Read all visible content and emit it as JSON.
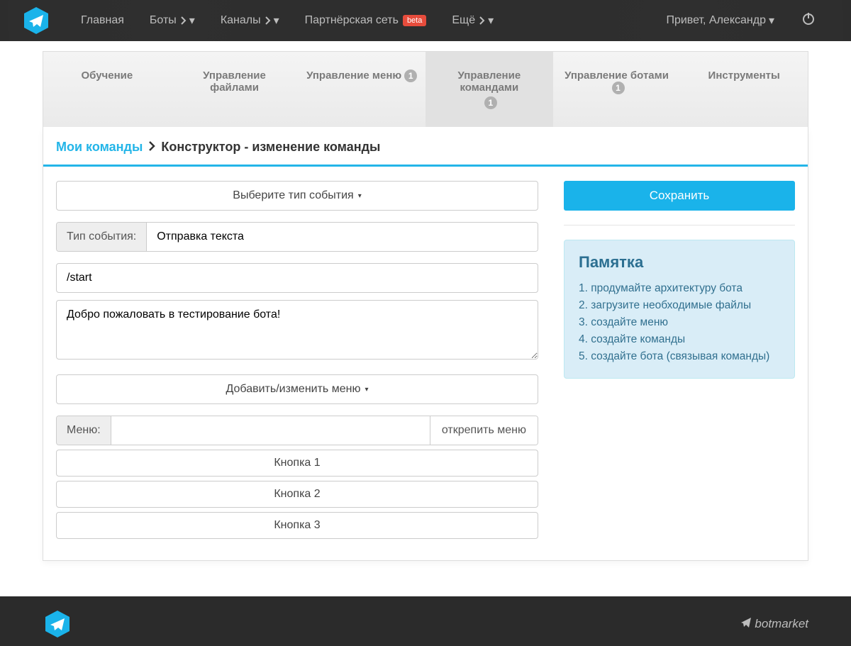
{
  "nav": {
    "home": "Главная",
    "bots": "Боты",
    "channels": "Каналы",
    "partner": "Партнёрская сеть",
    "beta": "beta",
    "more": "Ещё",
    "greeting": "Привет, Александр"
  },
  "tabs": {
    "training": "Обучение",
    "files": "Управление файлами",
    "menu": "Управление меню",
    "menu_badge": "1",
    "commands": "Управление командами",
    "commands_badge": "1",
    "bots": "Управление ботами",
    "bots_badge": "1",
    "tools": "Инструменты"
  },
  "breadcrumb": {
    "link": "Мои команды",
    "current": "Конструктор - изменение команды"
  },
  "form": {
    "select_event_type": "Выберите тип события",
    "event_type_label": "Тип события:",
    "event_type_value": "Отправка текста",
    "command": "/start",
    "message": "Добро пожаловать в тестирование бота!",
    "add_change_menu": "Добавить/изменить меню",
    "menu_label": "Меню:",
    "menu_value": "",
    "unpin_menu": "открепить меню",
    "buttons": [
      "Кнопка 1",
      "Кнопка 2",
      "Кнопка 3"
    ]
  },
  "side": {
    "save": "Сохранить",
    "memo_title": "Памятка",
    "memo_items": [
      "продумайте архитектуру бота",
      "загрузите необходимые файлы",
      "создайте меню",
      "создайте команды",
      "создайте бота (связывая команды)"
    ]
  },
  "footer": {
    "brand": "botmarket"
  }
}
